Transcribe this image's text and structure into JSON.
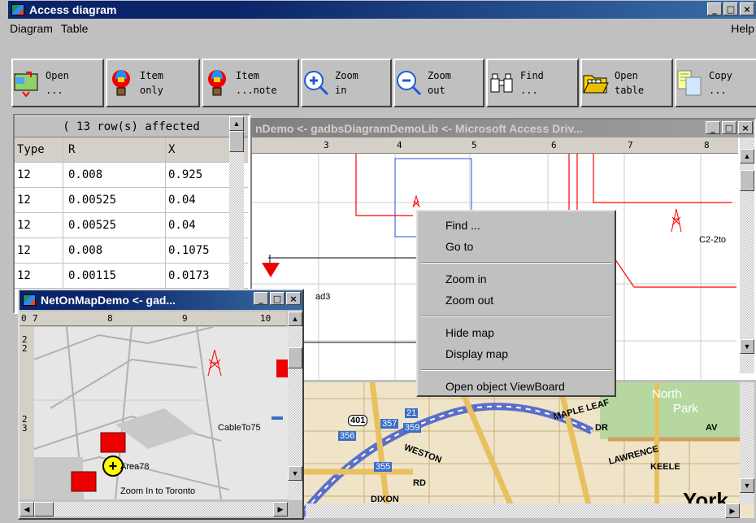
{
  "window": {
    "title": "Access diagram"
  },
  "menu": {
    "items": [
      "Diagram",
      "Table"
    ],
    "help": "Help"
  },
  "toolbar": [
    {
      "icon": "map-icon",
      "label": "Open\n..."
    },
    {
      "icon": "balloon-icon",
      "label": "Item\nonly"
    },
    {
      "icon": "balloon-note-icon",
      "label": "Item\n...note"
    },
    {
      "icon": "zoom-in-icon",
      "label": "Zoom\nin"
    },
    {
      "icon": "zoom-out-icon",
      "label": "Zoom\nout"
    },
    {
      "icon": "binoculars-icon",
      "label": "Find\n..."
    },
    {
      "icon": "open-folder-icon",
      "label": "Open\ntable"
    },
    {
      "icon": "copy-icon",
      "label": "Copy\n..."
    }
  ],
  "grid": {
    "status": "( 13 row(s) affected",
    "columns": [
      "Type",
      "R",
      "X"
    ],
    "rows": [
      [
        "12",
        "0.008",
        "0.925"
      ],
      [
        "12",
        "0.00525",
        "0.04"
      ],
      [
        "12",
        "0.00525",
        "0.04"
      ],
      [
        "12",
        "0.008",
        "0.1075"
      ],
      [
        "12",
        "0.00115",
        "0.0173"
      ]
    ]
  },
  "diagram": {
    "title": "nDemo <- gadbsDiagramDemoLib <- Microsoft Access Driv...",
    "ruler": [
      "3",
      "4",
      "5",
      "6",
      "7",
      "8"
    ],
    "labels": {
      "c2": "C2-2to",
      "ad3": "ad3"
    }
  },
  "context_menu": {
    "items": [
      "Find ...",
      "Go to",
      "Zoom in",
      "Zoom out",
      "Hide map",
      "Display map",
      "Open object ViewBoard"
    ]
  },
  "mini_window": {
    "title": "NetOnMapDemo <- gad...",
    "ruler": [
      "0",
      "7",
      "8",
      "9",
      "10"
    ],
    "vruler": [
      "2\n2",
      "2\n3"
    ],
    "labels": {
      "cable": "CableTo75",
      "area": "Area78",
      "zoom": "Zoom In to Toronto"
    }
  },
  "map": {
    "labels": [
      "401",
      "357",
      "21",
      "359",
      "356",
      "355",
      "WESTON",
      "RD",
      "DIXON",
      "MAPLE LEAF",
      "DR",
      "LAWRENCE",
      "KEELE",
      "North",
      "Park",
      "AV",
      "York"
    ]
  },
  "colors": {
    "accent": "#0a246a",
    "line": "#ff0000",
    "blue": "#0000ff"
  }
}
